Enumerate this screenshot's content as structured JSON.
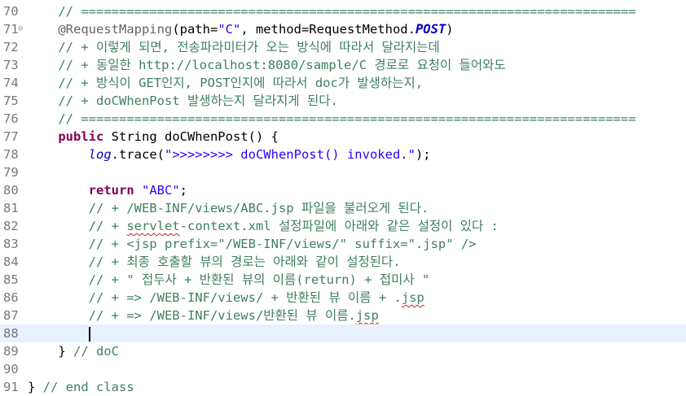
{
  "editor": {
    "current_line": 88,
    "lines": [
      {
        "num": "70",
        "fold": "",
        "indent": "    ",
        "segments": [
          {
            "t": "cmt",
            "v": "// ========================================================================="
          }
        ]
      },
      {
        "num": "71",
        "fold": "⊖",
        "indent": "    ",
        "segments": [
          {
            "t": "ann",
            "v": "@RequestMapping"
          },
          {
            "t": "plain",
            "v": "(path="
          },
          {
            "t": "str",
            "v": "\"C\""
          },
          {
            "t": "plain",
            "v": ", method=RequestMethod."
          },
          {
            "t": "sfld",
            "v": "POST"
          },
          {
            "t": "plain",
            "v": ")"
          }
        ]
      },
      {
        "num": "72",
        "fold": "",
        "indent": "    ",
        "segments": [
          {
            "t": "cmt",
            "v": "// + 이렇게 되면, 전송파라미터가 오는 방식에 따라서 달라지는데"
          }
        ]
      },
      {
        "num": "73",
        "fold": "",
        "indent": "    ",
        "segments": [
          {
            "t": "cmt",
            "v": "// + 동일한 http://localhost:8080/sample/C 경로로 요청이 들어와도"
          }
        ]
      },
      {
        "num": "74",
        "fold": "",
        "indent": "    ",
        "segments": [
          {
            "t": "cmt",
            "v": "// + 방식이 GET인지, POST인지에 따라서 doc가 발생하는지,"
          }
        ]
      },
      {
        "num": "75",
        "fold": "",
        "indent": "    ",
        "segments": [
          {
            "t": "cmt",
            "v": "// + doCWhenPost 발생하는지 달라지게 된다."
          }
        ]
      },
      {
        "num": "76",
        "fold": "",
        "indent": "    ",
        "segments": [
          {
            "t": "cmt",
            "v": "// ========================================================================="
          }
        ]
      },
      {
        "num": "77",
        "fold": "",
        "indent": "    ",
        "segments": [
          {
            "t": "kw",
            "v": "public"
          },
          {
            "t": "plain",
            "v": " String doCWhenPost() {"
          }
        ]
      },
      {
        "num": "78",
        "fold": "",
        "indent": "        ",
        "segments": [
          {
            "t": "fld",
            "v": "log"
          },
          {
            "t": "plain",
            "v": ".trace("
          },
          {
            "t": "str",
            "v": "\">>>>>>>> doCWhenPost() invoked.\""
          },
          {
            "t": "plain",
            "v": ");"
          }
        ]
      },
      {
        "num": "79",
        "fold": "",
        "indent": "",
        "segments": []
      },
      {
        "num": "80",
        "fold": "",
        "indent": "        ",
        "segments": [
          {
            "t": "kw",
            "v": "return"
          },
          {
            "t": "plain",
            "v": " "
          },
          {
            "t": "str",
            "v": "\"ABC\""
          },
          {
            "t": "plain",
            "v": ";"
          }
        ]
      },
      {
        "num": "81",
        "fold": "",
        "indent": "        ",
        "segments": [
          {
            "t": "cmt",
            "v": "// + /WEB-INF/views/ABC.jsp 파일을 불러오게 된다."
          }
        ]
      },
      {
        "num": "82",
        "fold": "",
        "indent": "        ",
        "segments": [
          {
            "t": "cmt",
            "v": "// + "
          },
          {
            "t": "cmt squig",
            "v": "servlet"
          },
          {
            "t": "cmt",
            "v": "-context.xml 설정파일에 아래와 같은 설정이 있다 :"
          }
        ]
      },
      {
        "num": "83",
        "fold": "",
        "indent": "        ",
        "segments": [
          {
            "t": "cmt",
            "v": "// + <jsp prefix=\"/WEB-INF/views/\" suffix=\".jsp\" />"
          }
        ]
      },
      {
        "num": "84",
        "fold": "",
        "indent": "        ",
        "segments": [
          {
            "t": "cmt",
            "v": "// + 최종 호출할 뷰의 경로는 아래와 같이 설정된다."
          }
        ]
      },
      {
        "num": "85",
        "fold": "",
        "indent": "        ",
        "segments": [
          {
            "t": "cmt",
            "v": "// + \" 접두사 + 반환된 뷰의 이름(return) + 접미사 \""
          }
        ]
      },
      {
        "num": "86",
        "fold": "",
        "indent": "        ",
        "segments": [
          {
            "t": "cmt",
            "v": "// + => /WEB-INF/views/ + 반환된 뷰 이름 + ."
          },
          {
            "t": "cmt squig",
            "v": "jsp"
          }
        ]
      },
      {
        "num": "87",
        "fold": "",
        "indent": "        ",
        "segments": [
          {
            "t": "cmt",
            "v": "// + => /WEB-INF/views/반환된 뷰 이름."
          },
          {
            "t": "cmt squig",
            "v": "jsp"
          }
        ]
      },
      {
        "num": "88",
        "fold": "",
        "indent": "        ",
        "segments": [],
        "caret": true
      },
      {
        "num": "89",
        "fold": "",
        "indent": "    ",
        "segments": [
          {
            "t": "plain",
            "v": "} "
          },
          {
            "t": "cmt",
            "v": "// doC"
          }
        ]
      },
      {
        "num": "90",
        "fold": "",
        "indent": "",
        "segments": []
      },
      {
        "num": "91",
        "fold": "",
        "indent": "",
        "segments": [
          {
            "t": "plain",
            "v": "} "
          },
          {
            "t": "cmt",
            "v": "// end class"
          }
        ]
      }
    ]
  }
}
